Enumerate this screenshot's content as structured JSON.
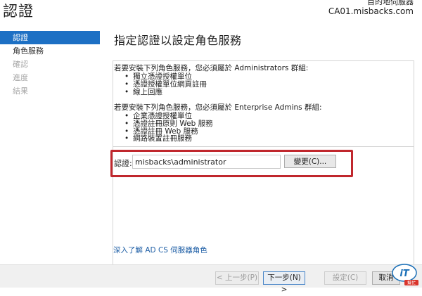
{
  "header": {
    "title": "認證",
    "destination_label": "目的地伺服器",
    "destination_server": "CA01.misbacks.com"
  },
  "nav": {
    "items": [
      {
        "label": "認證",
        "state": "active"
      },
      {
        "label": "角色服務",
        "state": "normal"
      },
      {
        "label": "確認",
        "state": "disabled"
      },
      {
        "label": "進度",
        "state": "disabled"
      },
      {
        "label": "結果",
        "state": "disabled"
      }
    ]
  },
  "main": {
    "page_title": "指定認證以設定角色服務",
    "admins_section": {
      "intro": "若要安裝下列角色服務，您必須屬於 Administrators 群組:",
      "items": [
        "獨立憑證授權單位",
        "憑證授權單位網頁註冊",
        "線上回應"
      ]
    },
    "enterprise_section": {
      "intro": "若要安裝下列角色服務，您必須屬於 Enterprise Admins 群組:",
      "items": [
        "企業憑證授權單位",
        "憑證註冊原則 Web 服務",
        "憑證註冊 Web 服務",
        "網路裝置註冊服務"
      ]
    },
    "credential": {
      "label": "認證:",
      "value": "misbacks\\administrator",
      "change_button": "變更(C)..."
    },
    "more_link": "深入了解 AD CS 伺服器角色"
  },
  "footer": {
    "previous": "< 上一步(P)",
    "next": "下一步(N) >",
    "configure": "設定(C)",
    "cancel": "取消"
  },
  "logo": {
    "text": "iT",
    "caption": "幫忙"
  },
  "colors": {
    "accent": "#1d70c4",
    "highlight_border": "#c0272d",
    "link": "#1f5fa6"
  }
}
